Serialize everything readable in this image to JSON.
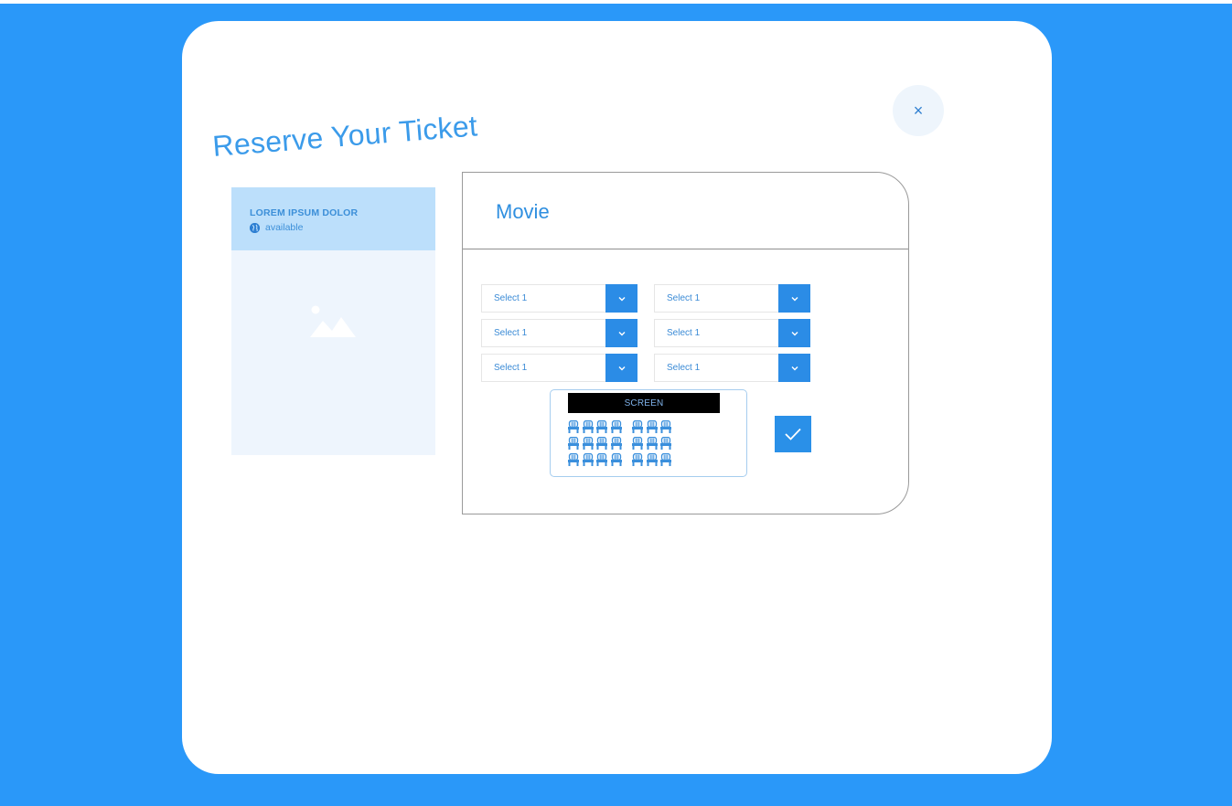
{
  "page": {
    "title": "Reserve Your Ticket",
    "close_symbol": "×"
  },
  "card": {
    "title": "LOREM IPSUM DOLOR",
    "status": "available",
    "status_icon": "globe-icon",
    "image_icon": "image-placeholder-icon"
  },
  "panel": {
    "title": "Movie",
    "selects": [
      {
        "label": "Select 1"
      },
      {
        "label": "Select 1"
      },
      {
        "label": "Select 1"
      },
      {
        "label": "Select 1"
      },
      {
        "label": "Select 1"
      },
      {
        "label": "Select 1"
      }
    ],
    "screen_label": "SCREEN",
    "seat_rows": 3,
    "seats_per_row": 7,
    "confirm_icon": "checkmark-icon"
  },
  "colors": {
    "background": "#2a98f9",
    "accent": "#2b8ce6",
    "title": "#3b9bea"
  }
}
